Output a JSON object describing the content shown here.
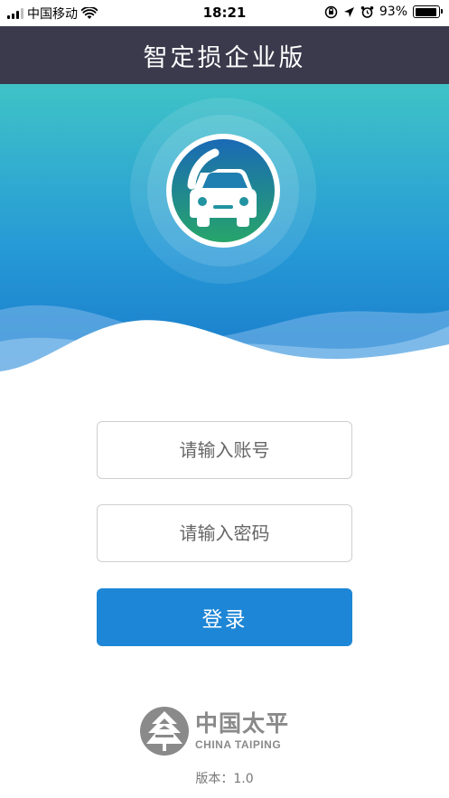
{
  "status_bar": {
    "carrier": "中国移动",
    "time": "18:21",
    "battery_percent": "93%",
    "battery_level": 0.93
  },
  "header": {
    "title": "智定损企业版"
  },
  "hero": {
    "icon": "car-icon"
  },
  "form": {
    "account_placeholder": "请输入账号",
    "account_value": "",
    "password_placeholder": "请输入密码",
    "password_value": "",
    "login_label": "登录"
  },
  "footer": {
    "logo_cn": "中国太平",
    "logo_en": "CHINA TAIPING",
    "version": "版本：1.0"
  },
  "colors": {
    "title_bar_bg": "#3a3a4c",
    "primary_button": "#1d86d6",
    "hero_top": "#3fc0c8",
    "hero_bottom": "#1a7fcc",
    "icon_ring_start": "#1a6fb8",
    "icon_ring_end": "#27a36a"
  }
}
